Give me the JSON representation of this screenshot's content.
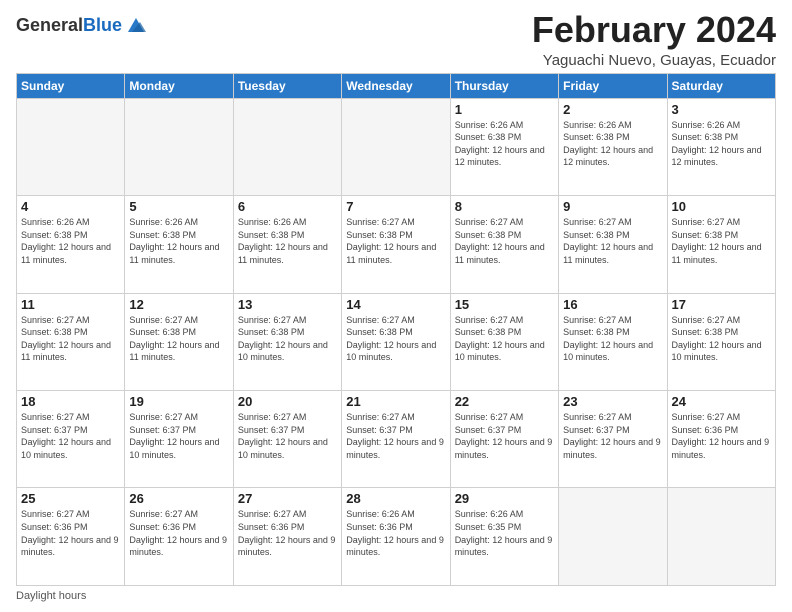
{
  "header": {
    "logo_general": "General",
    "logo_blue": "Blue",
    "month_title": "February 2024",
    "location": "Yaguachi Nuevo, Guayas, Ecuador"
  },
  "days_of_week": [
    "Sunday",
    "Monday",
    "Tuesday",
    "Wednesday",
    "Thursday",
    "Friday",
    "Saturday"
  ],
  "weeks": [
    [
      {
        "day": "",
        "info": ""
      },
      {
        "day": "",
        "info": ""
      },
      {
        "day": "",
        "info": ""
      },
      {
        "day": "",
        "info": ""
      },
      {
        "day": "1",
        "info": "Sunrise: 6:26 AM\nSunset: 6:38 PM\nDaylight: 12 hours and 12 minutes."
      },
      {
        "day": "2",
        "info": "Sunrise: 6:26 AM\nSunset: 6:38 PM\nDaylight: 12 hours and 12 minutes."
      },
      {
        "day": "3",
        "info": "Sunrise: 6:26 AM\nSunset: 6:38 PM\nDaylight: 12 hours and 12 minutes."
      }
    ],
    [
      {
        "day": "4",
        "info": "Sunrise: 6:26 AM\nSunset: 6:38 PM\nDaylight: 12 hours and 11 minutes."
      },
      {
        "day": "5",
        "info": "Sunrise: 6:26 AM\nSunset: 6:38 PM\nDaylight: 12 hours and 11 minutes."
      },
      {
        "day": "6",
        "info": "Sunrise: 6:26 AM\nSunset: 6:38 PM\nDaylight: 12 hours and 11 minutes."
      },
      {
        "day": "7",
        "info": "Sunrise: 6:27 AM\nSunset: 6:38 PM\nDaylight: 12 hours and 11 minutes."
      },
      {
        "day": "8",
        "info": "Sunrise: 6:27 AM\nSunset: 6:38 PM\nDaylight: 12 hours and 11 minutes."
      },
      {
        "day": "9",
        "info": "Sunrise: 6:27 AM\nSunset: 6:38 PM\nDaylight: 12 hours and 11 minutes."
      },
      {
        "day": "10",
        "info": "Sunrise: 6:27 AM\nSunset: 6:38 PM\nDaylight: 12 hours and 11 minutes."
      }
    ],
    [
      {
        "day": "11",
        "info": "Sunrise: 6:27 AM\nSunset: 6:38 PM\nDaylight: 12 hours and 11 minutes."
      },
      {
        "day": "12",
        "info": "Sunrise: 6:27 AM\nSunset: 6:38 PM\nDaylight: 12 hours and 11 minutes."
      },
      {
        "day": "13",
        "info": "Sunrise: 6:27 AM\nSunset: 6:38 PM\nDaylight: 12 hours and 10 minutes."
      },
      {
        "day": "14",
        "info": "Sunrise: 6:27 AM\nSunset: 6:38 PM\nDaylight: 12 hours and 10 minutes."
      },
      {
        "day": "15",
        "info": "Sunrise: 6:27 AM\nSunset: 6:38 PM\nDaylight: 12 hours and 10 minutes."
      },
      {
        "day": "16",
        "info": "Sunrise: 6:27 AM\nSunset: 6:38 PM\nDaylight: 12 hours and 10 minutes."
      },
      {
        "day": "17",
        "info": "Sunrise: 6:27 AM\nSunset: 6:38 PM\nDaylight: 12 hours and 10 minutes."
      }
    ],
    [
      {
        "day": "18",
        "info": "Sunrise: 6:27 AM\nSunset: 6:37 PM\nDaylight: 12 hours and 10 minutes."
      },
      {
        "day": "19",
        "info": "Sunrise: 6:27 AM\nSunset: 6:37 PM\nDaylight: 12 hours and 10 minutes."
      },
      {
        "day": "20",
        "info": "Sunrise: 6:27 AM\nSunset: 6:37 PM\nDaylight: 12 hours and 10 minutes."
      },
      {
        "day": "21",
        "info": "Sunrise: 6:27 AM\nSunset: 6:37 PM\nDaylight: 12 hours and 9 minutes."
      },
      {
        "day": "22",
        "info": "Sunrise: 6:27 AM\nSunset: 6:37 PM\nDaylight: 12 hours and 9 minutes."
      },
      {
        "day": "23",
        "info": "Sunrise: 6:27 AM\nSunset: 6:37 PM\nDaylight: 12 hours and 9 minutes."
      },
      {
        "day": "24",
        "info": "Sunrise: 6:27 AM\nSunset: 6:36 PM\nDaylight: 12 hours and 9 minutes."
      }
    ],
    [
      {
        "day": "25",
        "info": "Sunrise: 6:27 AM\nSunset: 6:36 PM\nDaylight: 12 hours and 9 minutes."
      },
      {
        "day": "26",
        "info": "Sunrise: 6:27 AM\nSunset: 6:36 PM\nDaylight: 12 hours and 9 minutes."
      },
      {
        "day": "27",
        "info": "Sunrise: 6:27 AM\nSunset: 6:36 PM\nDaylight: 12 hours and 9 minutes."
      },
      {
        "day": "28",
        "info": "Sunrise: 6:26 AM\nSunset: 6:36 PM\nDaylight: 12 hours and 9 minutes."
      },
      {
        "day": "29",
        "info": "Sunrise: 6:26 AM\nSunset: 6:35 PM\nDaylight: 12 hours and 9 minutes."
      },
      {
        "day": "",
        "info": ""
      },
      {
        "day": "",
        "info": ""
      }
    ]
  ],
  "footer": {
    "daylight_label": "Daylight hours"
  }
}
